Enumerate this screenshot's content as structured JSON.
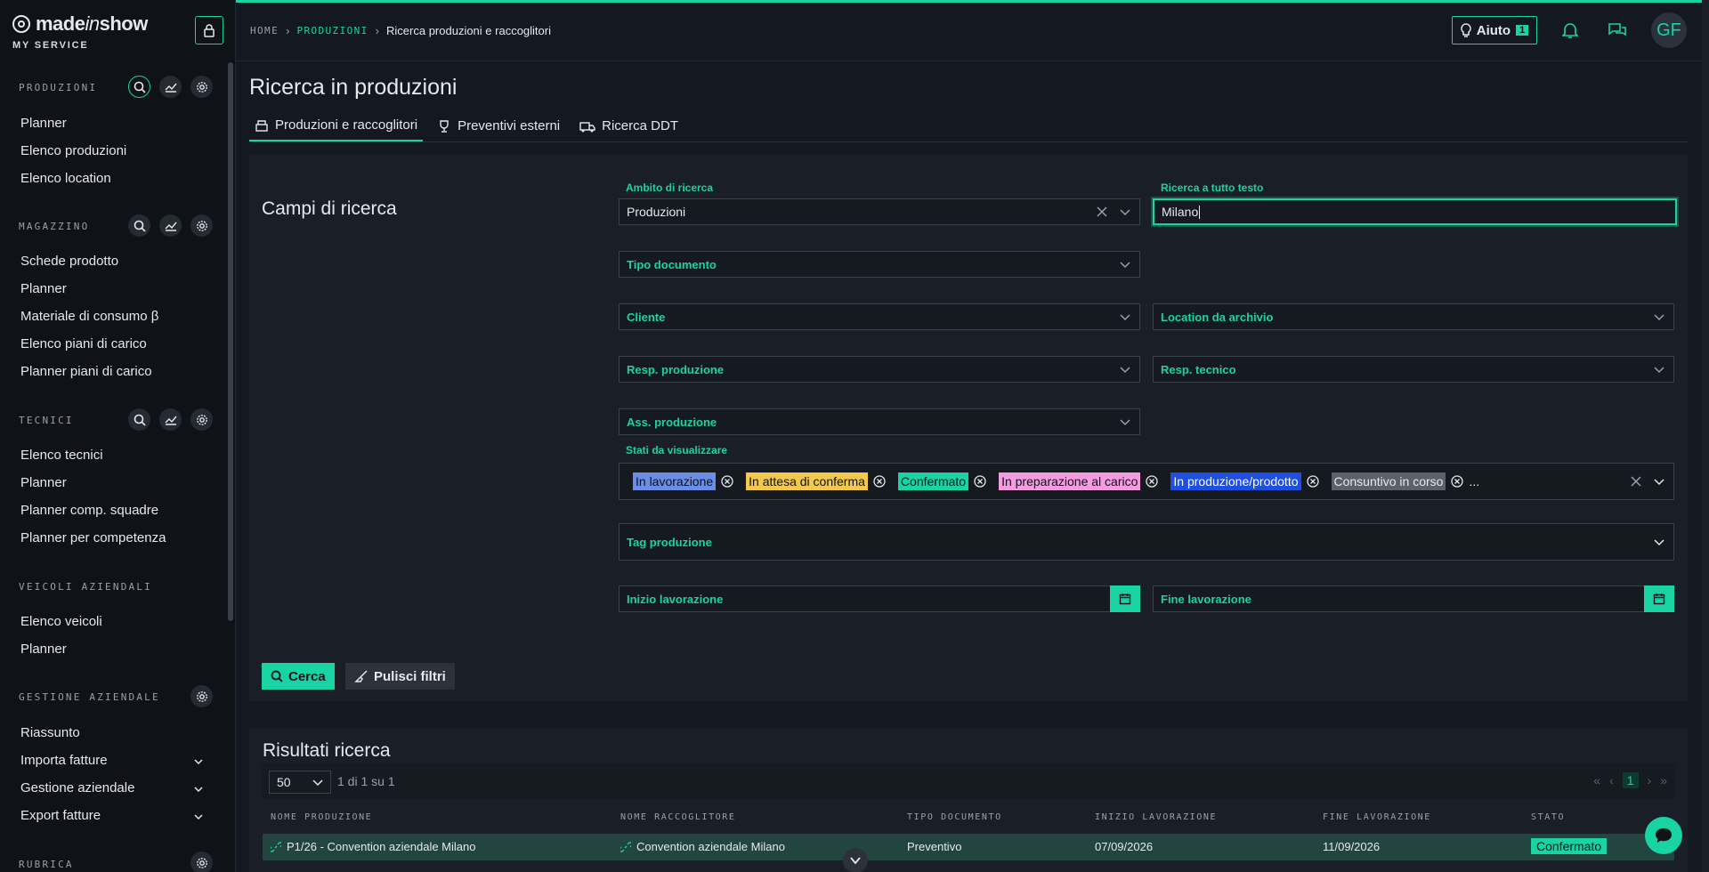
{
  "brand": {
    "name_pre": "made",
    "name_italic": "in",
    "name_post": "show",
    "subtitle": "MY SERVICE"
  },
  "sidebar": {
    "sections": [
      {
        "title": "PRODUZIONI",
        "items": [
          "Planner",
          "Elenco produzioni",
          "Elenco location"
        ]
      },
      {
        "title": "MAGAZZINO",
        "items": [
          "Schede prodotto",
          "Planner",
          "Materiale di consumo β",
          "Elenco piani di carico",
          "Planner piani di carico"
        ]
      },
      {
        "title": "TECNICI",
        "items": [
          "Elenco tecnici",
          "Planner",
          "Planner comp. squadre",
          "Planner per competenza"
        ]
      },
      {
        "title": "VEICOLI AZIENDALI",
        "items": [
          "Elenco veicoli",
          "Planner"
        ]
      },
      {
        "title": "GESTIONE AZIENDALE",
        "items": [
          "Riassunto",
          "Importa fatture",
          "Gestione aziendale",
          "Export fatture"
        ]
      },
      {
        "title": "RUBRICA",
        "items": []
      }
    ]
  },
  "breadcrumb": {
    "home": "HOME",
    "section": "PRODUZIONI",
    "current": "Ricerca produzioni e raccoglitori"
  },
  "header": {
    "help_label": "Aiuto",
    "help_count": "1",
    "avatar_initials": "GF"
  },
  "page": {
    "title": "Ricerca in produzioni",
    "tabs": [
      "Produzioni e raccoglitori",
      "Preventivi esterni",
      "Ricerca DDT"
    ]
  },
  "search": {
    "panel_title": "Campi di ricerca",
    "scope_label": "Ambito di ricerca",
    "scope_value": "Produzioni",
    "fulltext_label": "Ricerca a tutto testo",
    "fulltext_value": "Milano",
    "doc_type": "Tipo documento",
    "client": "Cliente",
    "location": "Location da archivio",
    "resp_prod": "Resp. produzione",
    "resp_tech": "Resp. tecnico",
    "ass_prod": "Ass. produzione",
    "states_label": "Stati da visualizzare",
    "states": [
      {
        "label": "In lavorazione",
        "bg": "#6b8de6",
        "fg": "#0f1217"
      },
      {
        "label": "In attesa di conferma",
        "bg": "#f2c94c",
        "fg": "#0f1217"
      },
      {
        "label": "Confermato",
        "bg": "#19d3a3",
        "fg": "#0f1217"
      },
      {
        "label": "In preparazione al carico",
        "bg": "#f59be0",
        "fg": "#0f1217"
      },
      {
        "label": "In produzione/prodotto",
        "bg": "#1f4fe0",
        "fg": "#ffffff"
      },
      {
        "label": "Consuntivo in corso",
        "bg": "#5d6169",
        "fg": "#e6e8ec"
      }
    ],
    "states_more": "...",
    "tag_prod": "Tag produzione",
    "start": "Inizio lavorazione",
    "end": "Fine lavorazione",
    "search_btn": "Cerca",
    "clear_btn": "Pulisci filtri"
  },
  "results": {
    "title": "Risultati ricerca",
    "page_size": "50",
    "page_info": "1 di 1 su 1",
    "current_page": "1",
    "columns": [
      "NOME PRODUZIONE",
      "NOME RACCOGLITORE",
      "TIPO DOCUMENTO",
      "INIZIO LAVORAZIONE",
      "FINE LAVORAZIONE",
      "STATO"
    ],
    "rows": [
      {
        "name": "P1/26 - Convention aziendale Milano",
        "collector": "Convention aziendale Milano",
        "doc_type": "Preventivo",
        "start": "07/09/2026",
        "end": "11/09/2026",
        "status": "Confermato"
      }
    ]
  },
  "colors": {
    "accent": "#19d3a3",
    "background": "#141820",
    "sidebar": "#0f1217",
    "panel": "#1a1e26"
  }
}
